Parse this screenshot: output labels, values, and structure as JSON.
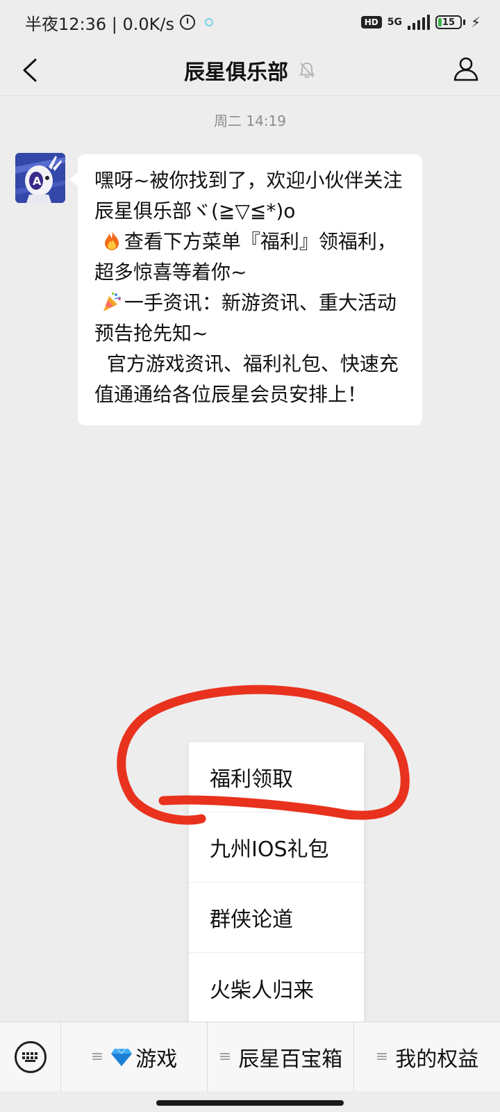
{
  "status_bar": {
    "time": "半夜12:36 | 0.0K/s",
    "hd": "HD",
    "network": "5G",
    "battery": "15"
  },
  "nav": {
    "title": "辰星俱乐部"
  },
  "chat": {
    "timestamp": "周二 14:19",
    "message": {
      "line1": "嘿呀~被你找到了，欢迎小伙伴关注辰星俱乐部ヾ(≧▽≦*)o",
      "line2": "查看下方菜单『福利』领福利，超多惊喜等着你~",
      "line3": "一手资讯：新游资讯、重大活动预告抢先知~",
      "line4": "官方游戏资讯、福利礼包、快速充值通通给各位辰星会员安排上！"
    }
  },
  "popup_menu": {
    "items": [
      {
        "label": "福利领取"
      },
      {
        "label": "九州IOS礼包"
      },
      {
        "label": "群侠论道"
      },
      {
        "label": "火柴人归来"
      }
    ]
  },
  "bottom_menu": {
    "menu_glyph": "≡",
    "items": [
      {
        "label": "游戏"
      },
      {
        "label": "辰星百宝箱"
      },
      {
        "label": "我的权益"
      }
    ]
  },
  "colors": {
    "background": "#ededed",
    "bubble": "#ffffff",
    "annotation_red": "#e8321e"
  }
}
